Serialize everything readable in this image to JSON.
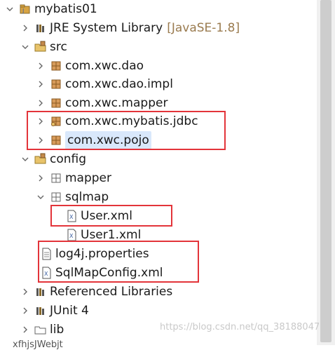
{
  "tree": {
    "project": "mybatis01",
    "jre_label": "JRE System Library",
    "jre_decoration": "[JavaSE-1.8]",
    "src": "src",
    "packages": [
      "com.xwc.dao",
      "com.xwc.dao.impl",
      "com.xwc.mapper",
      "com.xwc.mybatis.jdbc",
      "com.xwc.pojo"
    ],
    "config": "config",
    "mapper_folder": "mapper",
    "sqlmap_folder": "sqlmap",
    "files": [
      "User.xml",
      "User1.xml",
      "log4j.properties",
      "SqlMapConfig.xml"
    ],
    "referenced": "Referenced Libraries",
    "junit": "JUnit 4",
    "lib": "lib",
    "next_project_partial": "xfhjsJWebjt"
  },
  "watermark": "https://blog.csdn.net/qq_38188047",
  "colors": {
    "highlight_box": "#e3343a",
    "selection": "#d9e8fb",
    "decoration": "#9a7b4f"
  }
}
